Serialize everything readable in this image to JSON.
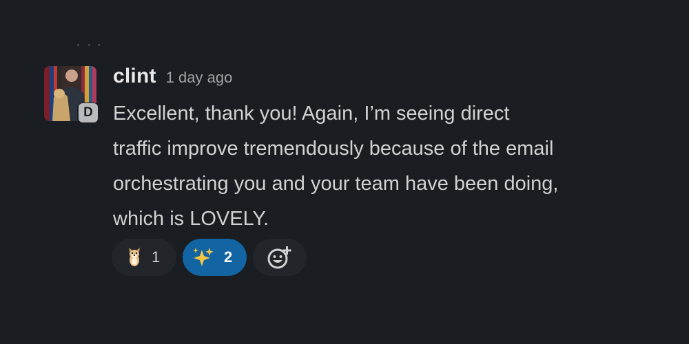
{
  "message": {
    "author": "clint",
    "timestamp": "1 day ago",
    "avatar": {
      "icon": "user-avatar-photo",
      "badge_letter": "D"
    },
    "lines": [
      "Excellent, thank you! Again, I’m seeing direct",
      "traffic improve tremendously because of the email",
      "orchestrating you and your team have been doing,",
      "which is LOVELY."
    ]
  },
  "reactions": [
    {
      "emoji": "dog-emoji-icon",
      "count": "1",
      "active": false
    },
    {
      "emoji": "sparkles-emoji-icon",
      "count": "2",
      "active": true
    }
  ],
  "add_reaction": {
    "icon": "add-reaction-icon"
  },
  "colors": {
    "background": "#1a1d21",
    "text": "#d1d2d3",
    "pill": "#222529",
    "active_pill": "#1264a3",
    "sparkle": "#f5c542"
  }
}
